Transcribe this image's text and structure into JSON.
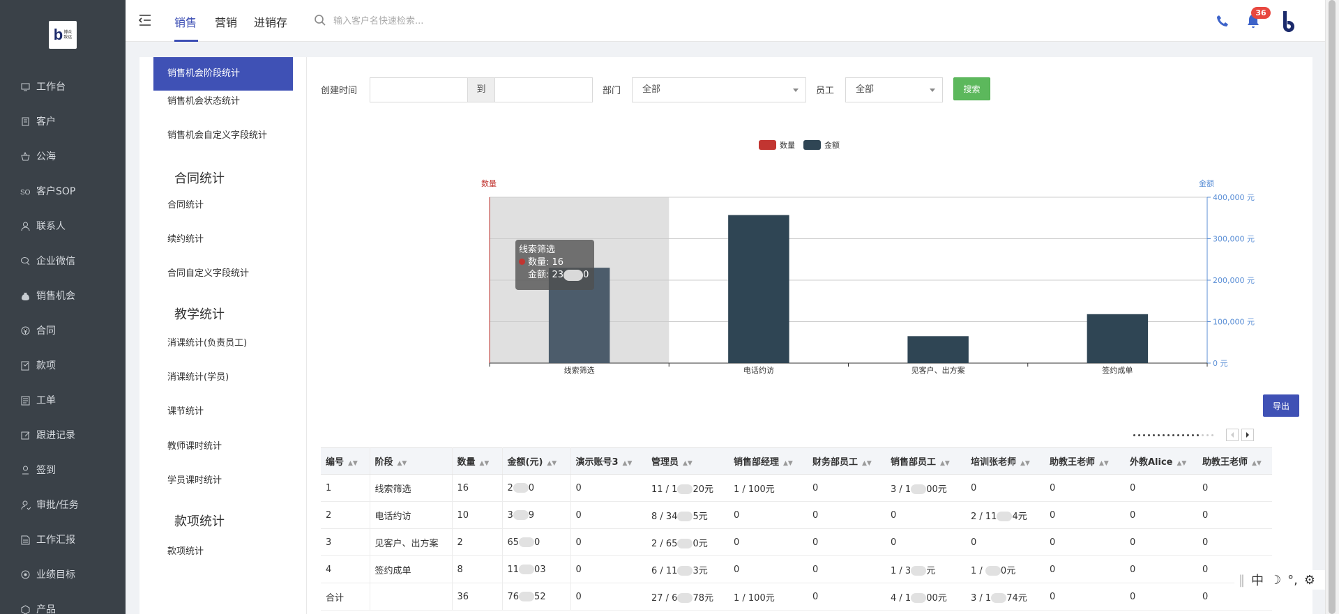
{
  "logo": {
    "line1": "博众",
    "line2": "致远"
  },
  "sidebar": {
    "items": [
      {
        "label": "工作台",
        "icon": "desktop-icon"
      },
      {
        "label": "客户",
        "icon": "building-icon"
      },
      {
        "label": "公海",
        "icon": "basket-icon"
      },
      {
        "label": "客户SOP",
        "icon": "sop-icon"
      },
      {
        "label": "联系人",
        "icon": "user-icon"
      },
      {
        "label": "企业微信",
        "icon": "wechat-icon"
      },
      {
        "label": "销售机会",
        "icon": "moneybag-icon"
      },
      {
        "label": "合同",
        "icon": "coin-icon"
      },
      {
        "label": "款项",
        "icon": "payment-icon"
      },
      {
        "label": "工单",
        "icon": "ticket-icon"
      },
      {
        "label": "跟进记录",
        "icon": "edit-icon"
      },
      {
        "label": "签到",
        "icon": "checkin-icon"
      },
      {
        "label": "审批/任务",
        "icon": "approval-icon"
      },
      {
        "label": "工作汇报",
        "icon": "report-icon"
      },
      {
        "label": "业绩目标",
        "icon": "target-icon"
      },
      {
        "label": "产品",
        "icon": "box-icon"
      }
    ]
  },
  "header": {
    "tabs": [
      "销售",
      "营销",
      "进销存"
    ],
    "active_tab": "销售",
    "search_placeholder": "输入客户名快速检索...",
    "notification_count": "36"
  },
  "stats_menu": {
    "items": [
      {
        "label": "销售机会阶段统计",
        "type": "item",
        "active": true
      },
      {
        "label": "销售机会状态统计",
        "type": "item"
      },
      {
        "label": "销售机会自定义字段统计",
        "type": "item"
      },
      {
        "label": "合同统计",
        "type": "group"
      },
      {
        "label": "合同统计",
        "type": "item"
      },
      {
        "label": "续约统计",
        "type": "item"
      },
      {
        "label": "合同自定义字段统计",
        "type": "item"
      },
      {
        "label": "教学统计",
        "type": "group"
      },
      {
        "label": "消课统计(负责员工)",
        "type": "item"
      },
      {
        "label": "消课统计(学员)",
        "type": "item"
      },
      {
        "label": "课节统计",
        "type": "item"
      },
      {
        "label": "教师课时统计",
        "type": "item"
      },
      {
        "label": "学员课时统计",
        "type": "item"
      },
      {
        "label": "款项统计",
        "type": "group"
      },
      {
        "label": "款项统计",
        "type": "item"
      }
    ]
  },
  "filters": {
    "created_label": "创建时间",
    "to_label": "到",
    "dept_label": "部门",
    "dept_value": "全部",
    "staff_label": "员工",
    "staff_value": "全部",
    "search_button": "搜索"
  },
  "chart_data": {
    "type": "bar",
    "legend_position": "top-center",
    "categories": [
      "线索筛选",
      "电话约访",
      "见客户、出方案",
      "签约成单"
    ],
    "series": [
      {
        "name": "数量",
        "color": "#c23531",
        "values": [
          16,
          10,
          2,
          8
        ],
        "axis": "left"
      },
      {
        "name": "金额",
        "color": "#2f4554",
        "values": [
          230000,
          357000,
          65000,
          118000
        ],
        "axis": "right"
      }
    ],
    "y_left_label": "数量",
    "y_right_label": "金额",
    "y_right_ticks": [
      "0 元",
      "100,000 元",
      "200,000 元",
      "300,000 元",
      "400,000 元"
    ],
    "y_right_range": [
      0,
      400000
    ],
    "grid": true,
    "highlighted_category": "线索筛选",
    "tooltip": {
      "title": "线索筛选",
      "count_label": "数量: 16",
      "amount_label": "金额: 23"
    }
  },
  "export_button": "导出",
  "table": {
    "columns": [
      "编号",
      "阶段",
      "数量",
      "金额(元)",
      "演示账号3",
      "管理员",
      "销售部经理",
      "财务部员工",
      "销售部员工",
      "培训张老师",
      "助教王老师",
      "外教Alice",
      "助教王老师"
    ],
    "rows": [
      [
        "1",
        "线索筛选",
        "16",
        "2",
        "0",
        "11 / 1",
        "1 / 100元",
        "0",
        "3 / 1",
        "0",
        "0",
        "0",
        "0"
      ],
      [
        "2",
        "电话约访",
        "10",
        "3",
        "0",
        "8 / 34",
        "0",
        "0",
        "0",
        "2 / 11",
        "0",
        "0",
        "0"
      ],
      [
        "3",
        "见客户、出方案",
        "2",
        "65",
        "0",
        "2 / 65",
        "0",
        "0",
        "0",
        "0",
        "0",
        "0",
        "0"
      ],
      [
        "4",
        "签约成单",
        "8",
        "11",
        "0",
        "6 / 11",
        "0",
        "0",
        "1 / 3",
        "1 / ",
        "0",
        "0",
        "0"
      ],
      [
        "合计",
        "",
        "36",
        "76",
        "0",
        "27 / 6",
        "1 / 100元",
        "0",
        "4 / 1",
        "3 / 1",
        "0",
        "0",
        "0"
      ]
    ],
    "cell_suffix": {
      "r0": {
        "c3": "0",
        "c5": "20元",
        "c8": "00元"
      },
      "r1": {
        "c3": "9",
        "c5": "5元",
        "c9": "4元"
      },
      "r2": {
        "c3": "0",
        "c5": "0元"
      },
      "r3": {
        "c3": "03",
        "c5": "3元",
        "c8": "元",
        "c9": "0元"
      },
      "r4": {
        "c3": "52",
        "c5": "78元",
        "c8": "00元",
        "c9": "74元"
      }
    }
  },
  "ime": {
    "lang": "中",
    "mode": "☽",
    "punct": "°,",
    "settings": "⚙"
  }
}
